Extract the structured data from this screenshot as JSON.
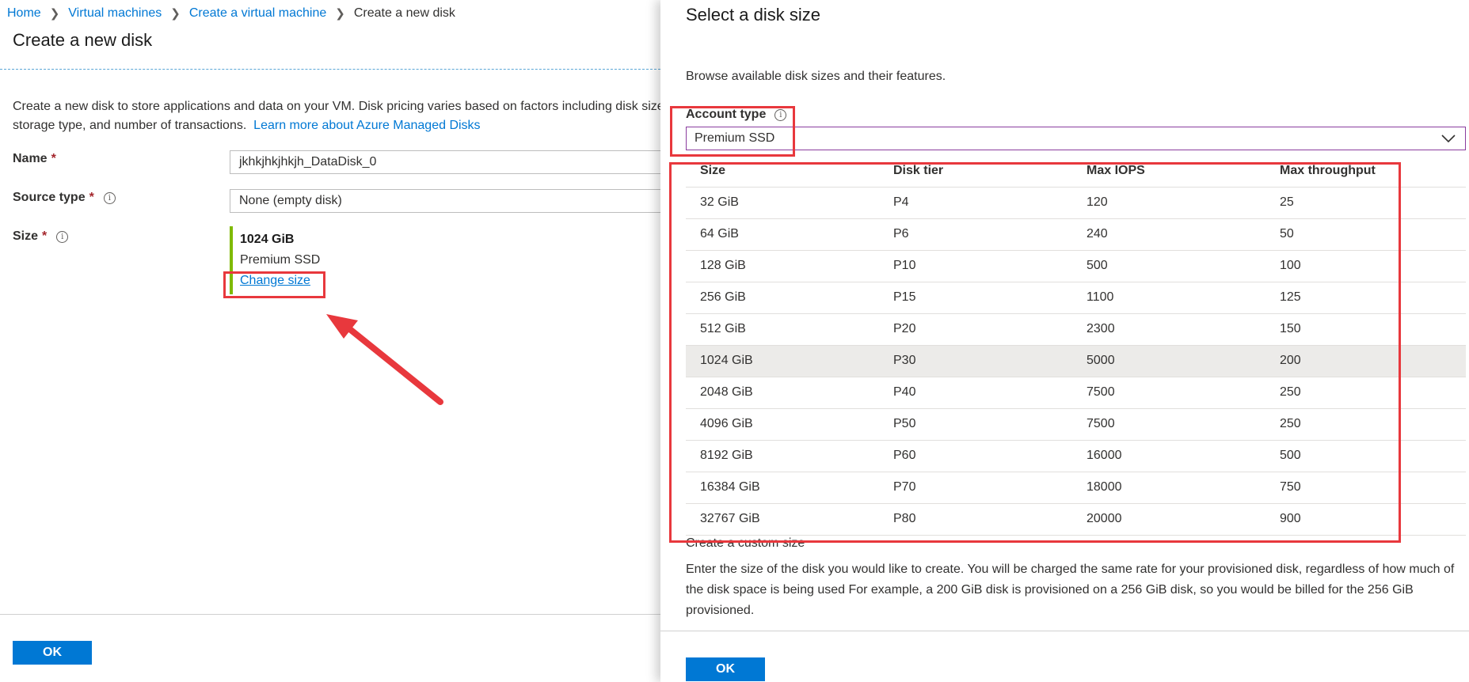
{
  "breadcrumb": {
    "items": [
      "Home",
      "Virtual machines",
      "Create a virtual machine"
    ],
    "current": "Create a new disk"
  },
  "left": {
    "title": "Create a new disk",
    "intro_line1": "Create a new disk to store applications and data on your VM. Disk pricing varies based on factors including disk size,",
    "intro_line2": "storage type, and number of transactions.",
    "learn_more": "Learn more about Azure Managed Disks",
    "name_label": "Name",
    "name_value": "jkhkjhkjhkjh_DataDisk_0",
    "source_label": "Source type",
    "source_value": "None (empty disk)",
    "size_label": "Size",
    "size_value": "1024 GiB",
    "size_tier": "Premium SSD",
    "change_size": "Change size",
    "required_mark": "*",
    "ok": "OK"
  },
  "right": {
    "title": "Select a disk size",
    "description": "Browse available disk sizes and their features.",
    "account_type_label": "Account type",
    "account_type_value": "Premium SSD",
    "columns": [
      "Size",
      "Disk tier",
      "Max IOPS",
      "Max throughput"
    ],
    "rows": [
      [
        "32 GiB",
        "P4",
        "120",
        "25"
      ],
      [
        "64 GiB",
        "P6",
        "240",
        "50"
      ],
      [
        "128 GiB",
        "P10",
        "500",
        "100"
      ],
      [
        "256 GiB",
        "P15",
        "1100",
        "125"
      ],
      [
        "512 GiB",
        "P20",
        "2300",
        "150"
      ],
      [
        "1024 GiB",
        "P30",
        "5000",
        "200"
      ],
      [
        "2048 GiB",
        "P40",
        "7500",
        "250"
      ],
      [
        "4096 GiB",
        "P50",
        "7500",
        "250"
      ],
      [
        "8192 GiB",
        "P60",
        "16000",
        "500"
      ],
      [
        "16384 GiB",
        "P70",
        "18000",
        "750"
      ],
      [
        "32767 GiB",
        "P80",
        "20000",
        "900"
      ]
    ],
    "selected_size": "1024 GiB",
    "custom_title": "Create a custom size",
    "custom_desc": "Enter the size of the disk you would like to create. You will be charged the same rate for your provisioned disk, regardless of how much of the disk space is being used For example, a 200 GiB disk is provisioned on a 256 GiB disk, so you would be billed for the 256 GiB provisioned.",
    "ok": "OK"
  },
  "colors": {
    "accent": "#0078d4",
    "required": "#a4262c",
    "size_bar": "#7fba00",
    "annotation": "#e8383d",
    "select_border": "#8a3c9e"
  }
}
